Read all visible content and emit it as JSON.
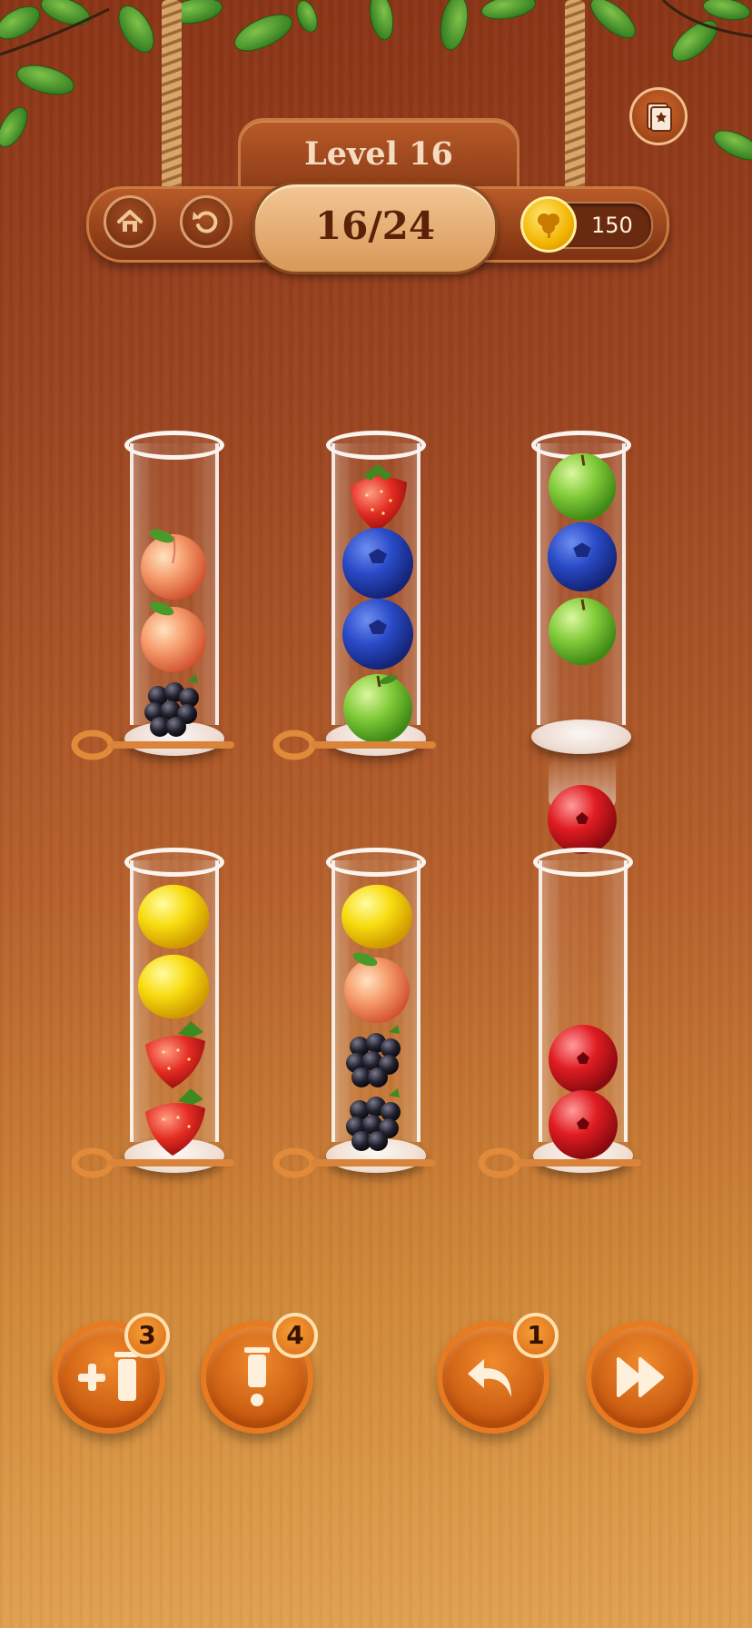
{
  "header": {
    "level_label": "Level 16",
    "progress_label": "16/24",
    "coins": "150"
  },
  "icons": {
    "home": "home-icon",
    "restart": "restart-icon",
    "coin": "clover-coin-icon",
    "corner": "collection-book-icon"
  },
  "tubes": [
    {
      "id": 1,
      "fruits_top_to_bottom": [
        "peach",
        "peach",
        "blackberry"
      ]
    },
    {
      "id": 2,
      "fruits_top_to_bottom": [
        "strawberry",
        "blueberry",
        "blueberry",
        "green-apple"
      ]
    },
    {
      "id": 3,
      "fruits_top_to_bottom": [
        "green-apple",
        "blueberry",
        "green-apple"
      ]
    },
    {
      "id": 4,
      "fruits_top_to_bottom": [
        "lemon",
        "lemon",
        "strawberry",
        "strawberry"
      ]
    },
    {
      "id": 5,
      "fruits_top_to_bottom": [
        "lemon",
        "peach",
        "blackberry",
        "blackberry"
      ]
    },
    {
      "id": 6,
      "fruits_top_to_bottom": [
        "cranberry",
        "cranberry"
      ]
    }
  ],
  "moving_fruit": "cranberry",
  "boosters": {
    "add_tube_count": "3",
    "remove_count": "4",
    "undo_count": "1",
    "skip": ""
  },
  "colors": {
    "wood_dark": "#8a3416",
    "wood_light": "#e0a050",
    "button_orange": "#e87a20",
    "coin_gold": "#f2b400"
  }
}
